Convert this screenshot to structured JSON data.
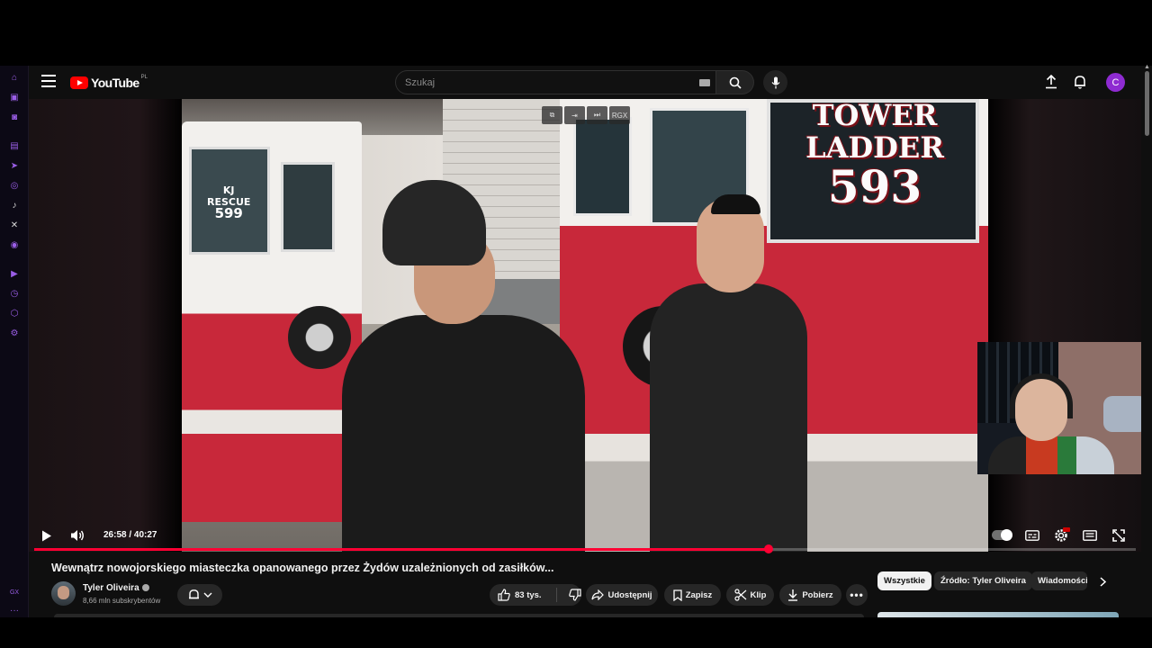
{
  "header": {
    "logo_text": "YouTube",
    "country_code": "PL",
    "search_placeholder": "Szukaj",
    "avatar_letter": "C"
  },
  "video": {
    "watermark_truck_left_1": "KJ",
    "watermark_truck_left_2": "RESCUE",
    "watermark_truck_left_3": "599",
    "truck_text_line1": "TOWER",
    "truck_text_line2": "LADDER",
    "truck_text_number": "593",
    "mini_controls": [
      "⧉",
      "⇥",
      "⏭",
      "RGX"
    ]
  },
  "player": {
    "current_time": "26:58",
    "duration": "40:27",
    "time_display": "26:58 / 40:27",
    "progress_fraction": 0.6667
  },
  "details": {
    "title": "Wewnątrz nowojorskiego miasteczka opanowanego przez Żydów uzależnionych od zasiłków...",
    "channel_name": "Tyler Oliveira",
    "subscribers": "8,66 mln subskrybentów",
    "like_count": "83 tys.",
    "share_label": "Udostępnij",
    "save_label": "Zapisz",
    "clip_label": "Klip",
    "download_label": "Pobierz"
  },
  "chips": [
    "Wszystkie",
    "Źródło: Tyler Oliveira",
    "Wiadomości"
  ],
  "colors": {
    "accent": "#ff0033",
    "background": "#0f0f0f",
    "pill": "#272727",
    "avatar": "#8e2bd1",
    "gx_accent": "#9a5ee6"
  }
}
